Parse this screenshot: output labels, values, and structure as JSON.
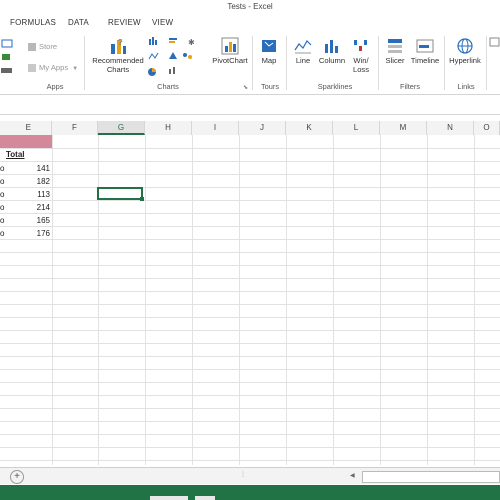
{
  "window": {
    "title": "Tests - Excel"
  },
  "tabs": [
    "FORMULAS",
    "DATA",
    "REVIEW",
    "VIEW"
  ],
  "ribbon": {
    "apps": {
      "store": "Store",
      "my_apps": "My Apps",
      "group": "Apps"
    },
    "charts": {
      "recommended_line1": "Recommended",
      "recommended_line2": "Charts",
      "pivotchart": "PivotChart",
      "group": "Charts"
    },
    "tours": {
      "map": "Map",
      "group": "Tours"
    },
    "sparklines": {
      "line": "Line",
      "column": "Column",
      "winloss_line1": "Win/",
      "winloss_line2": "Loss",
      "group": "Sparklines"
    },
    "filters": {
      "slicer": "Slicer",
      "timeline": "Timeline",
      "group": "Filters"
    },
    "links": {
      "hyperlink": "Hyperlink",
      "group": "Links"
    }
  },
  "columns": [
    "E",
    "F",
    "G",
    "H",
    "I",
    "J",
    "K",
    "L",
    "M",
    "N",
    "O"
  ],
  "selected_column": "G",
  "table": {
    "header": "Total",
    "values": [
      "141",
      "182",
      "113",
      "214",
      "165",
      "176"
    ]
  },
  "colors": {
    "accent": "#217346",
    "header_fill": "#d4899a"
  }
}
